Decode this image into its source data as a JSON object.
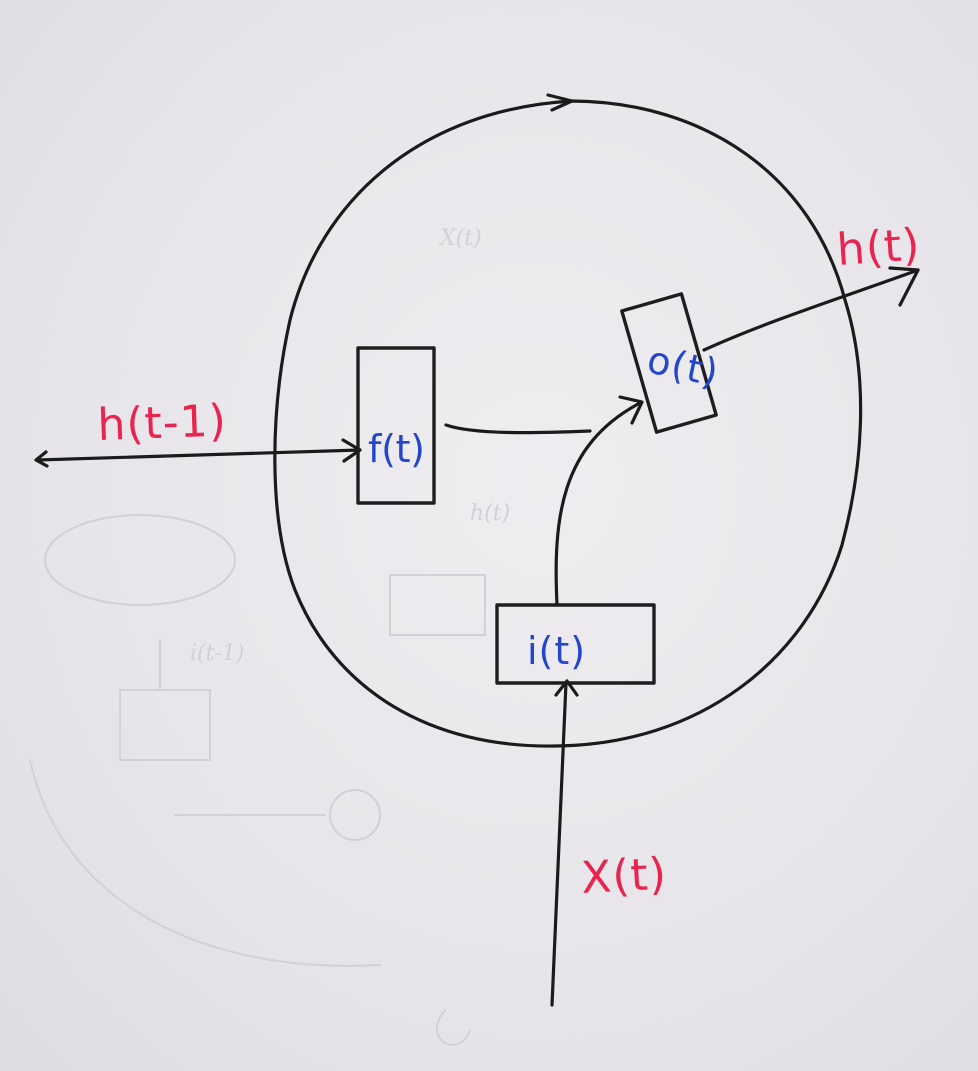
{
  "colors": {
    "ink": "#1b1b1b",
    "red_label": "#e8244f",
    "blue_label": "#2347c8",
    "paper": "#e9e7ea"
  },
  "labels": {
    "h_prev": "h(t-1)",
    "h_out": "h(t)",
    "x_in": "X(t)"
  },
  "gates": {
    "forget": "f(t)",
    "input": "i(t)",
    "output": "o(t)"
  }
}
